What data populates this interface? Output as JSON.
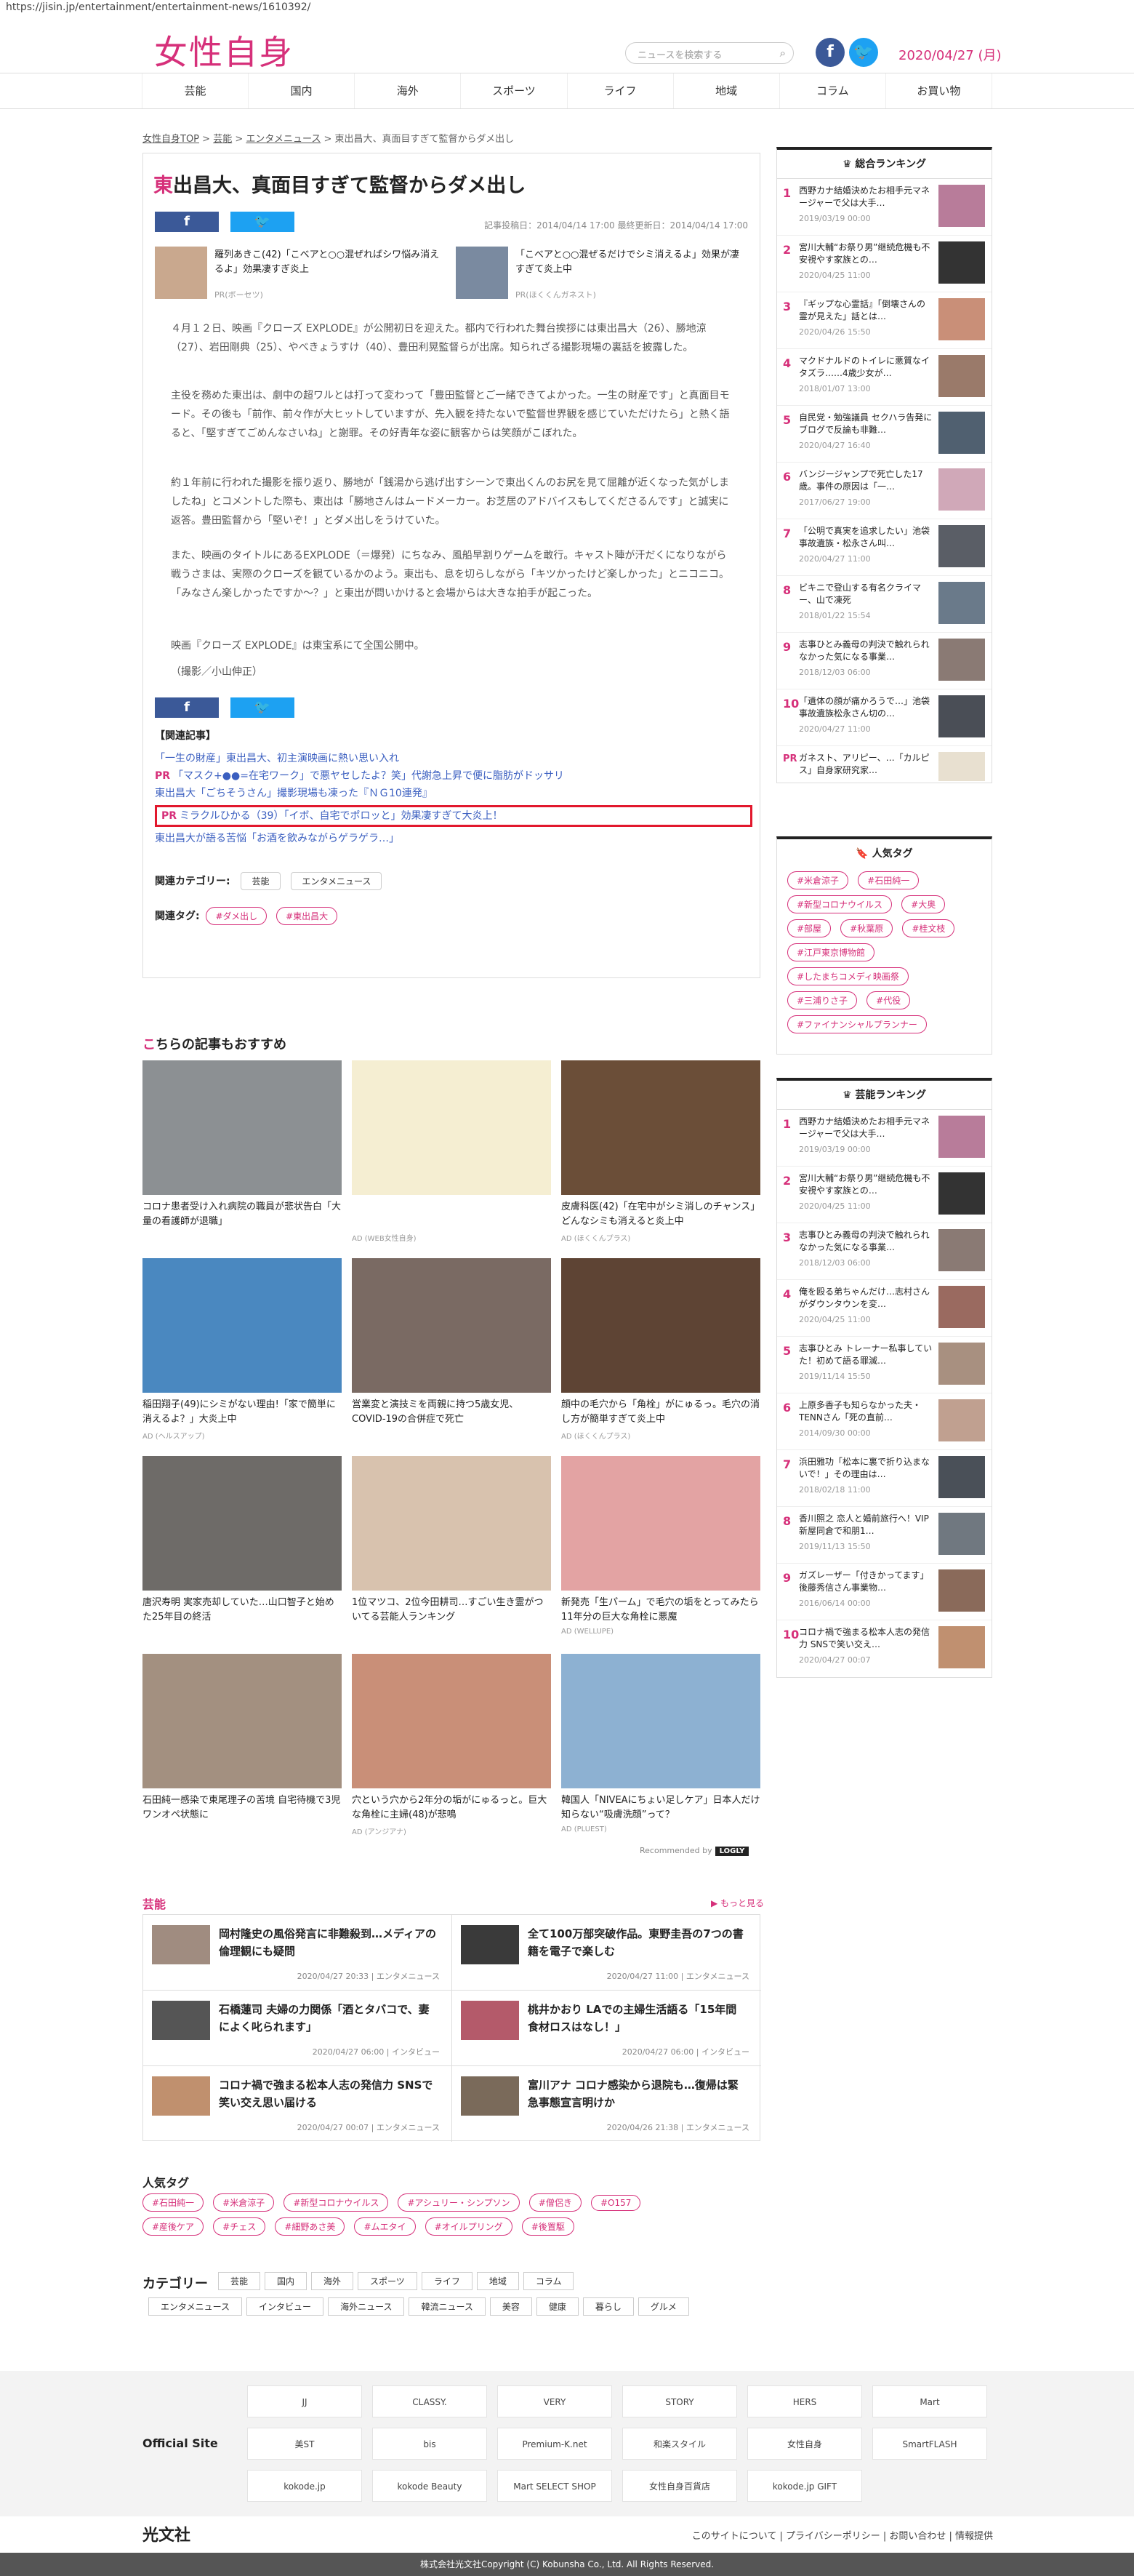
{
  "url": "https://jisin.jp/entertainment/entertainment-news/1610392/",
  "header": {
    "logo": "女性自身",
    "search_placeholder": "ニュースを検索する",
    "date": "2020/04/27 (月)"
  },
  "nav": [
    "芸能",
    "国内",
    "海外",
    "スポーツ",
    "ライフ",
    "地域",
    "コラム",
    "お買い物"
  ],
  "breadcrumb": {
    "home": "女性自身TOP",
    "c1": "芸能",
    "c2": "エンタメニュース",
    "current": "東出昌大、真面目すぎて監督からダメ出し"
  },
  "article": {
    "title_first": "東",
    "title_rest": "出昌大、真面目すぎて監督からダメ出し",
    "meta": "記事投稿日：2014/04/14 17:00 最終更新日：2014/04/14 17:00",
    "pr_left": {
      "title": "羅列あきこ(42)「こべアと○○混ぜればシワ悩み消えるよ」効果凄すぎ炎上",
      "source": "PR(ボーセツ)"
    },
    "pr_right": {
      "title": "「こべアと○○混ぜるだけでシミ消えるよ」効果が凄すぎて炎上中",
      "source": "PR(ほくくんガネスト)"
    },
    "p1": "４月１２日、映画『クローズ EXPLODE』が公開初日を迎えた。都内で行われた舞台挨拶には東出昌大（26）、勝地涼（27）、岩田剛典（25）、やべきょうすけ（40）、豊田利晃監督らが出席。知られざる撮影現場の裏話を披露した。",
    "p2": "主役を務めた東出は、劇中の超ワルとは打って変わって「豊田監督とご一緒できてよかった。一生の財産です」と真面目モード。その後も「前作、前々作が大ヒットしていますが、先入観を持たないで監督世界観を感じていただけたら」と熱く語ると、「堅すぎてごめんなさいね」と謝罪。その好青年な姿に観客からは笑顔がこぼれた。",
    "p3": "約１年前に行われた撮影を振り返り、勝地が「銭湯から逃げ出すシーンで東出くんのお尻を見て屈離が近くなった気がしましたね」とコメントした際も、東出は「勝地さんはムードメーカー。お芝居のアドバイスもしてくださるんです」と誠実に返答。豊田監督から「堅いぞ！」とダメ出しをうけていた。",
    "p4": "また、映画のタイトルにあるEXPLODE（＝爆発）にちなみ、風船早割りゲームを敢行。キャスト陣が汗だくになりながら戦うさまは、実際のクローズを観ているかのよう。東出も、息を切らしながら「キツかったけど楽しかった」とニコニコ。「みなさん楽しかったですか～？」と東出が問いかけると会場からは大きな拍手が起こった。",
    "p5": "映画『クローズ EXPLODE』は東宝系にて全国公開中。",
    "p6": "（撮影／小山伸正）",
    "related_head": "【関連記事】",
    "related": [
      "「一生の財産」東出昌大、初主演映画に熱い思い入れ",
      "「マスク+●●=在宅ワーク」で悪ヤセしたよ？笑」代謝急上昇で便に脂肪がドッサリ",
      "東出昌大「ごちそうさん」撮影現場も凍った『ＮＧ10連発』",
      "ミラクルひかる（39）「イボ、自宅でポロッと」効果凄すぎて大炎上！",
      "東出昌大が語る苦悩「お酒を飲みながらゲラゲラ…」"
    ],
    "pr_label": "PR",
    "cat_label": "関連カテゴリー:",
    "cats": [
      "芸能",
      "エンタメニュース"
    ],
    "tag_label": "関連タグ:",
    "tags": [
      "#ダメ出し",
      "#東出昌大"
    ]
  },
  "recommend": {
    "title_first": "こ",
    "title_rest": "ちらの記事もおすすめ",
    "items": [
      {
        "t": "コロナ患者受け入れ病院の職員が悲状告白「大量の看護師が退職」",
        "ad": ""
      },
      {
        "t": "",
        "ad": "AD (WEB女性自身)"
      },
      {
        "t": "皮膚科医(42)「在宅中がシミ消しのチャンス」どんなシミも消えると炎上中",
        "ad": "AD (ほくくんプラス)"
      },
      {
        "t": "稲田翔子(49)にシミがない理由!「家で簡単に消えるよ？」大炎上中",
        "ad": "AD (ヘルスアップ)"
      },
      {
        "t": "営業変と演技ミを両親に持つ5歳女児、COVID-19の合併症で死亡",
        "ad": ""
      },
      {
        "t": "顔中の毛穴から「角栓」がにゅるっ。毛穴の消し方が簡単すぎて炎上中",
        "ad": "AD (ほくくんプラス)"
      },
      {
        "t": "唐沢寿明 実家売却していた…山口智子と始めた25年目の終活",
        "ad": ""
      },
      {
        "t": "1位マツコ、2位今田耕司…すごい生き霊がついてる芸能人ランキング",
        "ad": ""
      },
      {
        "t": "新発売「生パーム」で毛穴の垢をとってみたら11年分の巨大な角栓に悪魔",
        "ad": "AD (WELLUPE)"
      },
      {
        "t": "石田純一感染で東尾理子の苦境 自宅待機で3児ワンオペ状態に",
        "ad": ""
      },
      {
        "t": "穴という穴から2年分の垢がにゅるっと。巨大な角栓に主婦(48)が悲鳴",
        "ad": "AD (アンジアナ)"
      },
      {
        "t": "韓国人「NIVEAにちょい足しケア」日本人だけ知らない“吸膚洗顔”って？",
        "ad": "AD (PLUEST)"
      }
    ],
    "by": "Recommended by",
    "logo": "LOGLY"
  },
  "geino": {
    "title": "芸能",
    "more": "▶ もっと見る",
    "items": [
      {
        "t": "岡村隆史の風俗発言に非難殺到…メディアの倫理観にも疑問",
        "m": "2020/04/27 20:33 | エンタメニュース"
      },
      {
        "t": "全て100万部突破作品。東野圭吾の7つの書籍を電子で楽しむ",
        "m": "2020/04/27 11:00 | エンタメニュース"
      },
      {
        "t": "石橋蓮司 夫婦の力関係「酒とタバコで、妻によく叱られます」",
        "m": "2020/04/27 06:00 | インタビュー"
      },
      {
        "t": "桃井かおり LAでの主婦生活語る「15年間食材ロスはなし！」",
        "m": "2020/04/27 06:00 | インタビュー"
      },
      {
        "t": "コロナ禍で強まる松本人志の発信力 SNSで笑い交え思い届ける",
        "m": "2020/04/27 00:07 | エンタメニュース"
      },
      {
        "t": "富川アナ コロナ感染から退院も…復帰は緊急事態宣言明けか",
        "m": "2020/04/26 21:38 | エンタメニュース"
      }
    ]
  },
  "popular_tags": {
    "title": "人気タグ",
    "items": [
      "#石田純一",
      "#米倉涼子",
      "#新型コロナウイルス",
      "#アシュリー・シンプソン",
      "#僧侶き",
      "#O157",
      "#産後ケア",
      "#チェス",
      "#細野あさ美",
      "#ムエタイ",
      "#オイルプリング",
      "#後置駆"
    ]
  },
  "categories": {
    "title": "カテゴリー",
    "items": [
      "芸能",
      "国内",
      "海外",
      "スポーツ",
      "ライフ",
      "地域",
      "コラム",
      "エンタメニュース",
      "インタビュー",
      "海外ニュース",
      "韓流ニュース",
      "美容",
      "健康",
      "暮らし",
      "グルメ"
    ]
  },
  "official": {
    "title": "Official Site",
    "sites": [
      "JJ",
      "CLASSY.",
      "VERY",
      "STORY",
      "HERS",
      "Mart",
      "美ST",
      "bis",
      "Premium-K.net",
      "和楽スタイル",
      "女性自身",
      "SmartFLASH",
      "kokode.jp",
      "kokode Beauty",
      "Mart SELECT SHOP",
      "女性自身百貨店",
      "kokode.jp GIFT"
    ]
  },
  "footer": {
    "company": "光文社",
    "links": "このサイトについて | プライバシーポリシー | お問い合わせ | 情報提供",
    "copyright": "株式会社光文社Copyright (C) Kobunsha Co., Ltd. All Rights Reserved."
  },
  "sidebar": {
    "ranking_title": "総合ランキング",
    "ranking": [
      {
        "t": "西野カナ結婚決めたお相手元マネージャーで父は大手…",
        "d": "2019/03/19 00:00"
      },
      {
        "t": "宮川大輔“お祭り男”继続危機も不安視やす家族との…",
        "d": "2020/04/25 11:00"
      },
      {
        "t": "『ギップな心霊話』「倒壊さんの霊が見えた」話とは…",
        "d": "2020/04/26 15:50"
      },
      {
        "t": "マクドナルドのトイレに悪質なイタズラ……4歳少女が…",
        "d": "2018/01/07 13:00"
      },
      {
        "t": "自民党・勉強議員 セクハラ告発にブログで反論も非難…",
        "d": "2020/04/27 16:40"
      },
      {
        "t": "バンジージャンプで死亡した17歳。事件の原因は「一…",
        "d": "2017/06/27 19:00"
      },
      {
        "t": "「公明で真実を追求したい」池袋事故遺族・松永さん叫…",
        "d": "2020/04/27 11:00"
      },
      {
        "t": "ビキニで登山する有名クライマー、山で凍死",
        "d": "2018/01/22 15:54"
      },
      {
        "t": "志事ひとみ義母の判決で触れられなかった気になる事業…",
        "d": "2018/12/03 06:00"
      },
      {
        "t": "「遺体の顔が痛かろうで…」池袋事故遺族松永さん切の…",
        "d": "2020/04/27 11:00"
      }
    ],
    "ranking_pr": "ガネスト、アリピー、…「カルピス」自身家研究家…",
    "tags_title": "人気タグ",
    "tags": [
      "#米倉涼子",
      "#石田純一",
      "#新型コロナウイルス",
      "#大奥",
      "#部屋",
      "#秋葉原",
      "#桂文枝",
      "#江戸東京博物館",
      "#したまちコメディ映画祭",
      "#三浦りさ子",
      "#代役",
      "#ファイナンシャルプランナー"
    ],
    "geino_title": "芸能ランキング",
    "geino": [
      {
        "t": "西野カナ結婚決めたお相手元マネージャーで父は大手…",
        "d": "2019/03/19 00:00"
      },
      {
        "t": "宮川大輔“お祭り男”继続危機も不安視やす家族との…",
        "d": "2020/04/25 11:00"
      },
      {
        "t": "志事ひとみ義母の判決で触れられなかった気になる事業…",
        "d": "2018/12/03 06:00"
      },
      {
        "t": "俺を殴る弟ちゃんだけ…志村さんがダウンタウンを変…",
        "d": "2020/04/25 11:00"
      },
      {
        "t": "志事ひとみ トレーナー私事していた！初めて語る罪滅…",
        "d": "2019/11/14 15:50"
      },
      {
        "t": "上原多香子も知らなかった夫・TENNさん「死の直前…",
        "d": "2014/09/30 00:00"
      },
      {
        "t": "浜田雅功「松本に裏で折り込まないで！」その理由は…",
        "d": "2018/02/18 11:00"
      },
      {
        "t": "香川照之 恋人と婚前旅行へ！VIP新屋同倉で和朋1…",
        "d": "2019/11/13 15:50"
      },
      {
        "t": "ガズレーザー「付きかってます」後藤秀信さん事業物…",
        "d": "2016/06/14 00:00"
      },
      {
        "t": "コロナ禍で強まる松本人志の発信力 SNSで笑い交え…",
        "d": "2020/04/27 00:07"
      }
    ]
  }
}
